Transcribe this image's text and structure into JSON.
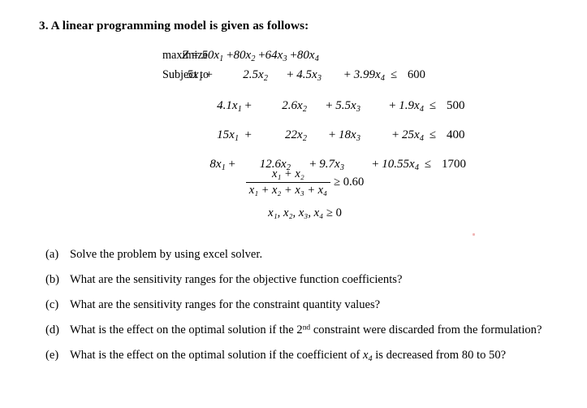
{
  "document": {
    "background_color": "#ffffff",
    "text_color": "#000000"
  },
  "heading": {
    "text": "3. A linear programming model is given as follows:"
  },
  "model": {
    "objective_label": "maximize",
    "subject_to_label": "Subject to",
    "objective": {
      "lhs": "Z",
      "equals": "=",
      "terms": [
        {
          "coefficient": "50",
          "variable": "x",
          "index": "1",
          "operator": ""
        },
        {
          "coefficient": "80",
          "variable": "x",
          "index": "2",
          "operator": "+"
        },
        {
          "coefficient": "64",
          "variable": "x",
          "index": "3",
          "operator": "+"
        },
        {
          "coefficient": "80",
          "variable": "x",
          "index": "4",
          "operator": "+"
        }
      ]
    },
    "constraints": [
      {
        "c1": "5",
        "c2": "2.5",
        "c3": "4.5",
        "c4": "3.99",
        "relation": "≤",
        "rhs": "600"
      },
      {
        "c1": "4.1",
        "c2": "2.6",
        "c3": "5.5",
        "c4": "1.9",
        "relation": "≤",
        "rhs": "500"
      },
      {
        "c1": "15",
        "c2": "22",
        "c3": "18",
        "c4": "25",
        "relation": "≤",
        "rhs": "400"
      },
      {
        "c1": "8",
        "c2": "12.6",
        "c3": "9.7",
        "c4": "10.55",
        "relation": "≤",
        "rhs": "1700"
      }
    ],
    "ratio_constraint": {
      "numerator": "x₁ + x₂",
      "denominator": "x₁ + x₂ + x₃ + x₄",
      "relation": "≥",
      "value": "0.60"
    },
    "nonnegativity": {
      "variables": "x₁, x₂, x₃, x₄",
      "relation": "≥",
      "value": "0"
    }
  },
  "questions": [
    {
      "marker": "(a)",
      "text": "Solve the problem by using excel solver."
    },
    {
      "marker": "(b)",
      "text": "What are the sensitivity ranges for the objective function coefficients?"
    },
    {
      "marker": "(c)",
      "text": "What are the sensitivity ranges for the constraint quantity values?"
    },
    {
      "marker": "(d)",
      "text_before_sup": "What is the effect on the optimal solution if the 2",
      "superscript": "nd",
      "text_after_sup": " constraint were discarded from the formulation?"
    },
    {
      "marker": "(e)",
      "text_before_var": "What is the effect on the optimal solution if the coefficient of ",
      "variable": "x",
      "variable_index": "4",
      "text_after_var": " is decreased from 80 to 50?"
    }
  ]
}
